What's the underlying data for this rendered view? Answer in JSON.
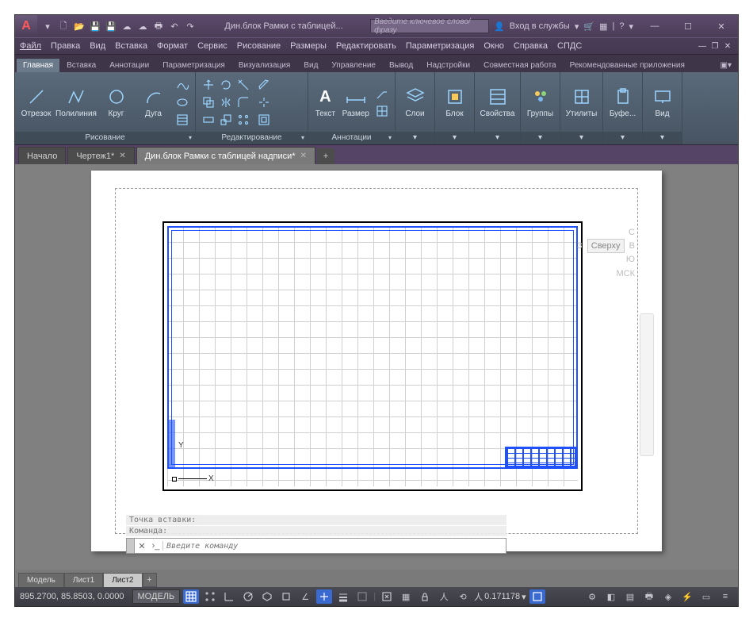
{
  "title": "Дин.блок Рамки с таблицей...",
  "search_placeholder": "Введите ключевое слово/фразу",
  "signin_label": "Вход в службы",
  "menu": [
    "Файл",
    "Правка",
    "Вид",
    "Вставка",
    "Формат",
    "Сервис",
    "Рисование",
    "Размеры",
    "Редактировать",
    "Параметризация",
    "Окно",
    "Справка",
    "СПДС"
  ],
  "ribbon_tabs": [
    "Главная",
    "Вставка",
    "Аннотации",
    "Параметризация",
    "Визуализация",
    "Вид",
    "Управление",
    "Вывод",
    "Надстройки",
    "Совместная работа",
    "Рекомендованные приложения"
  ],
  "ribbon_active": 0,
  "panels": {
    "draw": {
      "label": "Рисование",
      "btns": [
        "Отрезок",
        "Полилиния",
        "Круг",
        "Дуга"
      ]
    },
    "edit": {
      "label": "Редактирование"
    },
    "anno": {
      "label": "Аннотации",
      "btns": [
        "Текст",
        "Размер"
      ]
    },
    "layers": {
      "label": "Слои"
    },
    "block": {
      "label": "Блок"
    },
    "props": {
      "label": "Свойства"
    },
    "groups": {
      "label": "Группы"
    },
    "utils": {
      "label": "Утилиты"
    },
    "clip": {
      "label": "Буфе..."
    },
    "view": {
      "label": "Вид"
    }
  },
  "file_tabs": [
    {
      "label": "Начало",
      "active": false,
      "closable": false
    },
    {
      "label": "Чертеж1*",
      "active": false,
      "closable": true
    },
    {
      "label": "Дин.блок Рамки с таблицей надписи*",
      "active": true,
      "closable": true
    }
  ],
  "viewcube": {
    "axes": [
      "С",
      "З",
      "В",
      "Ю"
    ],
    "face": "Сверху",
    "wcs": "МСК"
  },
  "ucs": {
    "x": "X",
    "y": "Y"
  },
  "cmd_history": [
    "Точка вставки:",
    "Команда:"
  ],
  "cmd_placeholder": "Введите команду",
  "layout_tabs": [
    {
      "label": "Модель",
      "active": false
    },
    {
      "label": "Лист1",
      "active": false
    },
    {
      "label": "Лист2",
      "active": true
    }
  ],
  "status": {
    "coords": "895.2700, 85.8503, 0.0000",
    "space": "МОДЕЛЬ",
    "scale": "0.171178"
  }
}
